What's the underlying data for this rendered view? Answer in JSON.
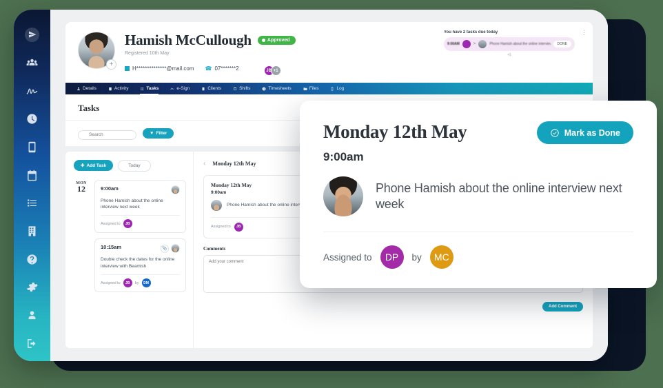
{
  "sidebar": {
    "items": [
      {
        "name": "logo-icon",
        "label": "Dashboard"
      },
      {
        "name": "users-icon",
        "label": "People"
      },
      {
        "name": "signature-icon",
        "label": "e-Sign"
      },
      {
        "name": "clock-icon",
        "label": "Timesheets"
      },
      {
        "name": "mobile-icon",
        "label": "Mobile"
      },
      {
        "name": "calendar-icon",
        "label": "Calendar"
      },
      {
        "name": "list-icon",
        "label": "Tasks"
      },
      {
        "name": "building-icon",
        "label": "Clients"
      },
      {
        "name": "question-icon",
        "label": "Help"
      },
      {
        "name": "gear-icon",
        "label": "Settings"
      },
      {
        "name": "user-icon",
        "label": "Account"
      },
      {
        "name": "logout-icon",
        "label": "Log out"
      }
    ]
  },
  "profile": {
    "name": "Hamish McCullough",
    "status_badge": "Approved",
    "registered": "Registered 10th May",
    "email": "H**************@mail.com",
    "phone": "07*******2",
    "avatar_add": "+",
    "mini_avatars": [
      {
        "initials": "JB",
        "color": "#9c27b0"
      },
      {
        "initials": "+1",
        "color": "#9aa3aa"
      }
    ],
    "kebab": "⋮"
  },
  "notification": {
    "title": "You have 2 tasks due today",
    "tag": "9:00AM",
    "arrow": ">",
    "text": "Phone Hamish about the online interview...",
    "action": "DONE",
    "more": "+1"
  },
  "nav": {
    "tabs": [
      {
        "label": "Details",
        "icon": "user-icon",
        "active": false
      },
      {
        "label": "Activity",
        "icon": "activity-icon",
        "active": false
      },
      {
        "label": "Tasks",
        "icon": "tasks-icon",
        "active": true
      },
      {
        "label": "e-Sign",
        "icon": "signature-icon",
        "active": false
      },
      {
        "label": "Clients",
        "icon": "clients-icon",
        "active": false
      },
      {
        "label": "Shifts",
        "icon": "shifts-icon",
        "active": false
      },
      {
        "label": "Timesheets",
        "icon": "timesheets-icon",
        "active": false
      },
      {
        "label": "Files",
        "icon": "files-icon",
        "active": false
      },
      {
        "label": "Log",
        "icon": "log-icon",
        "active": false
      }
    ]
  },
  "tasks_panel": {
    "title": "Tasks",
    "header_button": "Add Task",
    "search_placeholder": "Search",
    "search_value": "",
    "filter_button": "Filter",
    "add_task_button": "Add Task",
    "today_button": "Today"
  },
  "board": {
    "day": {
      "dow": "MON",
      "num": "12"
    },
    "cards": [
      {
        "time": "9:00am",
        "body": "Phone Hamish about the online interview next week",
        "assigned_label": "Assigned to",
        "assignee": {
          "initials": "JB",
          "color": "#9c27b0"
        },
        "has_attachment": false,
        "by_label": "",
        "author": null
      },
      {
        "time": "10:15am",
        "body": "Double check the dates for the online interview with Beamish",
        "assigned_label": "Assigned to",
        "assignee": {
          "initials": "JB",
          "color": "#9c27b0"
        },
        "has_attachment": true,
        "by_label": "by",
        "author": {
          "initials": "DM",
          "color": "#1667c7"
        }
      }
    ],
    "date_nav": {
      "prev": "‹",
      "title": "Monday 12th May",
      "next": "›"
    },
    "detail": {
      "date": "Monday 12th May",
      "time": "9:00am",
      "text": "Phone Hamish about the online interview next week",
      "assigned_label": "Assigned to",
      "assignee": {
        "initials": "JB",
        "color": "#9c27b0"
      }
    },
    "comments": {
      "label": "Comments",
      "placeholder": "Add your comment",
      "value": "",
      "submit": "Add Comment"
    }
  },
  "modal": {
    "title": "Monday 12th May",
    "mark_done": "Mark as Done",
    "time": "9:00am",
    "text": "Phone Hamish about the online interview next week",
    "assigned_label": "Assigned to",
    "by_label": "by",
    "assignee": {
      "initials": "DP",
      "color": "#a32ba8"
    },
    "author": {
      "initials": "MC",
      "color": "#dd9a12"
    }
  },
  "colors": {
    "page_background": "#4d7050",
    "teal_accent": "#17a2bd",
    "modal_teal": "#13a3bd",
    "approved_green": "#41b548",
    "purple": "#9c27b0",
    "gold": "#dd9a12",
    "navy": "#0b1526"
  }
}
